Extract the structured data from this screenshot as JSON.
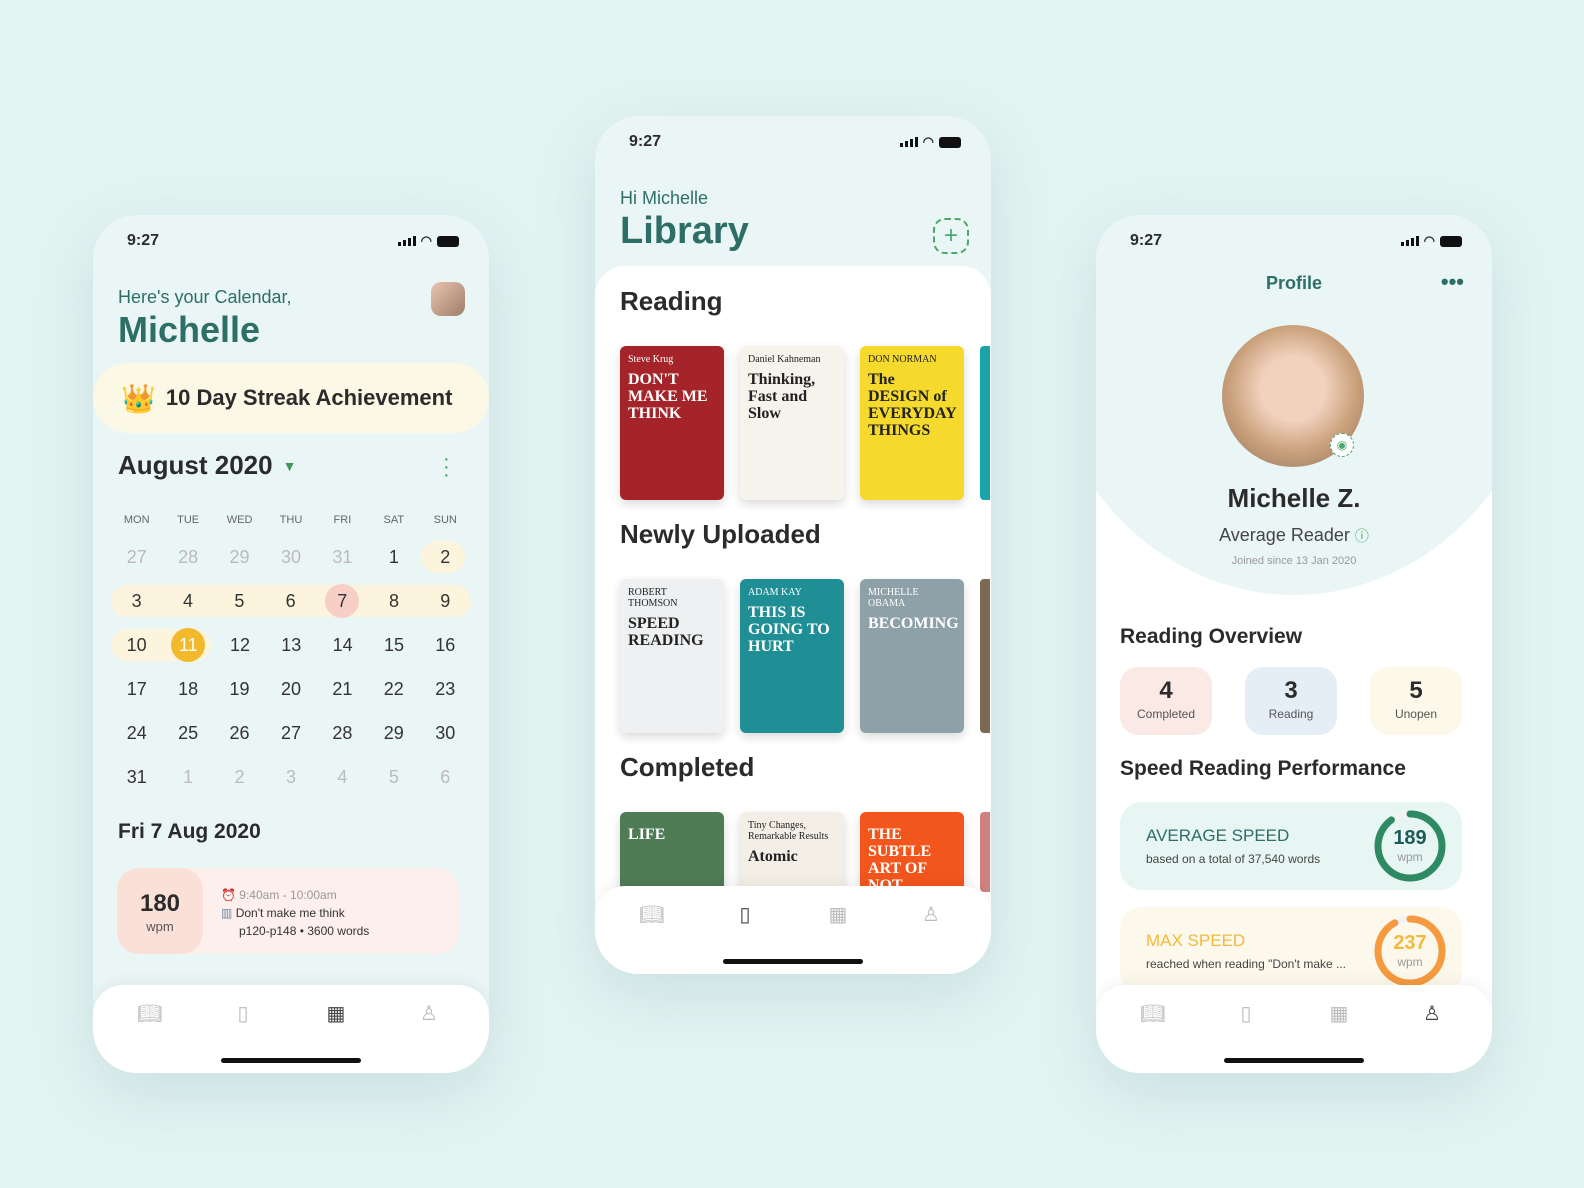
{
  "status_time": "9:27",
  "calendar": {
    "greeting": "Here's your Calendar,",
    "name": "Michelle",
    "streak": "10 Day Streak Achievement",
    "month": "August 2020",
    "weekdays": [
      "MON",
      "TUE",
      "WED",
      "THU",
      "FRI",
      "SAT",
      "SUN"
    ],
    "weeks": [
      [
        "27",
        "28",
        "29",
        "30",
        "31",
        "1",
        "2"
      ],
      [
        "3",
        "4",
        "5",
        "6",
        "7",
        "8",
        "9"
      ],
      [
        "10",
        "11",
        "12",
        "13",
        "14",
        "15",
        "16"
      ],
      [
        "17",
        "18",
        "19",
        "20",
        "21",
        "22",
        "23"
      ],
      [
        "24",
        "25",
        "26",
        "27",
        "28",
        "29",
        "30"
      ],
      [
        "31",
        "1",
        "2",
        "3",
        "4",
        "5",
        "6"
      ]
    ],
    "selected_date": "Fri 7 Aug 2020",
    "session": {
      "speed": "180",
      "unit": "wpm",
      "time": "9:40am - 10:00am",
      "book": "Don't make me think",
      "pages": "p120-p148 • 3600 words"
    }
  },
  "library": {
    "greeting": "Hi Michelle",
    "title": "Library",
    "sections": [
      {
        "title": "Reading",
        "books": [
          {
            "title": "DON'T MAKE ME THINK",
            "author": "Steve Krug",
            "color": "#a5242a"
          },
          {
            "title": "Thinking, Fast and Slow",
            "author": "Daniel Kahneman",
            "color": "#f6f3ec"
          },
          {
            "title": "The DESIGN of EVERYDAY THINGS",
            "author": "DON NORMAN",
            "color": "#f5d92c"
          }
        ]
      },
      {
        "title": "Newly Uploaded",
        "books": [
          {
            "title": "SPEED READING",
            "author": "ROBERT THOMSON",
            "color": "#eef0f2"
          },
          {
            "title": "THIS IS GOING TO HURT",
            "author": "ADAM KAY",
            "color": "#1f8f95"
          },
          {
            "title": "BECOMING",
            "author": "MICHELLE OBAMA",
            "color": "#8ea0a8"
          }
        ]
      },
      {
        "title": "Completed",
        "books": [
          {
            "title": "LIFE",
            "author": "",
            "color": "#4f7b55"
          },
          {
            "title": "Atomic",
            "author": "Tiny Changes, Remarkable Results",
            "color": "#f3efe6"
          },
          {
            "title": "THE SUBTLE ART OF NOT",
            "author": "",
            "color": "#f2561d"
          }
        ]
      }
    ]
  },
  "profile": {
    "header": "Profile",
    "name": "Michelle Z.",
    "level": "Average Reader",
    "joined": "Joined since 13 Jan 2020",
    "overview_title": "Reading Overview",
    "stats": [
      {
        "value": "4",
        "label": "Completed",
        "color": "#fbe9e5"
      },
      {
        "value": "3",
        "label": "Reading",
        "color": "#e5eef6"
      },
      {
        "value": "5",
        "label": "Unopen",
        "color": "#fcf8ea"
      }
    ],
    "perf_title": "Speed Reading Performance",
    "avg": {
      "label": "AVERAGE SPEED",
      "desc": "based on a total of 37,540 words",
      "value": "189",
      "unit": "wpm",
      "progress": 0.9
    },
    "max": {
      "label": "MAX SPEED",
      "desc": "reached when reading \"Don't make ...",
      "value": "237",
      "unit": "wpm",
      "progress": 0.92
    }
  }
}
